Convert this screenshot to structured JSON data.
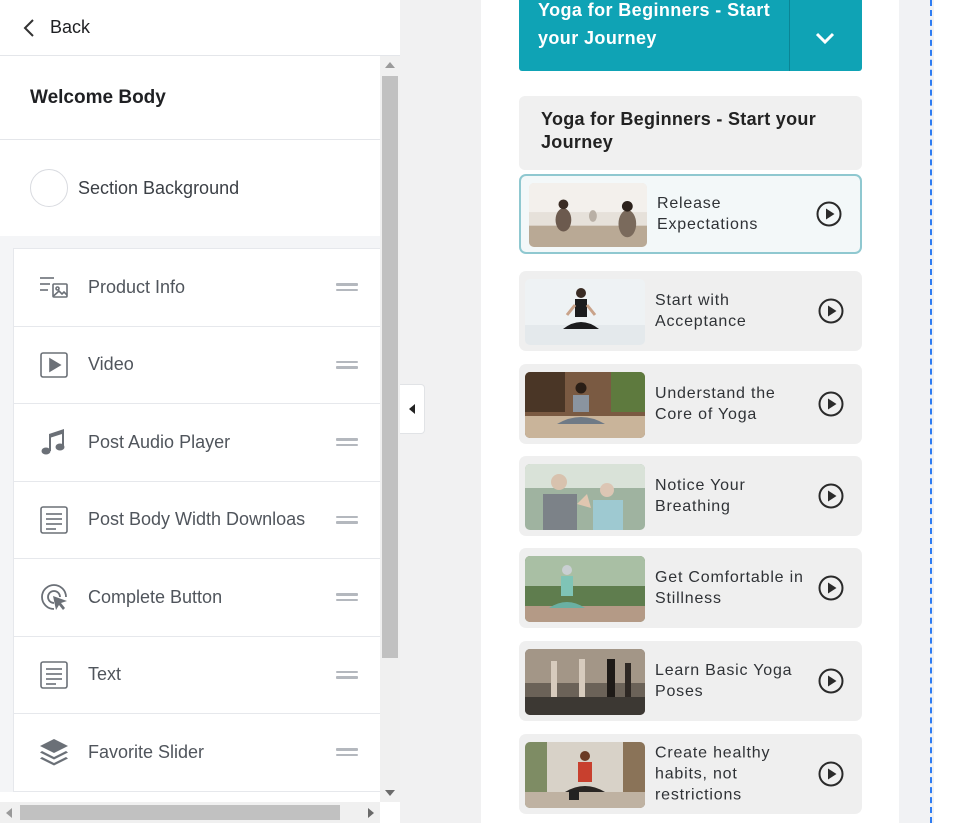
{
  "header": {
    "back_label": "Back"
  },
  "panel": {
    "section_title": "Welcome Body",
    "background_label": "Section Background",
    "items": [
      {
        "label": "Product Info",
        "icon": "product-info-icon"
      },
      {
        "label": "Video",
        "icon": "video-icon"
      },
      {
        "label": "Post Audio Player",
        "icon": "music-note-icon"
      },
      {
        "label": "Post Body Width Downloas",
        "icon": "document-icon"
      },
      {
        "label": "Complete Button",
        "icon": "click-cursor-icon"
      },
      {
        "label": "Text",
        "icon": "text-block-icon"
      },
      {
        "label": "Favorite Slider",
        "icon": "layers-icon"
      }
    ]
  },
  "preview": {
    "accordion_title": "Yoga for Beginners - Start your Journey",
    "course_title": "Yoga for Beginners - Start your Journey",
    "accent_color": "#0fa3b5",
    "lessons": [
      {
        "title": "Release Expectations",
        "active": true
      },
      {
        "title": "Start with Acceptance"
      },
      {
        "title": "Understand the Core of Yoga"
      },
      {
        "title": "Notice Your Breathing"
      },
      {
        "title": "Get Comfortable in Stillness"
      },
      {
        "title": "Learn Basic Yoga Poses"
      },
      {
        "title": "Create healthy habits, not restrictions"
      }
    ]
  }
}
